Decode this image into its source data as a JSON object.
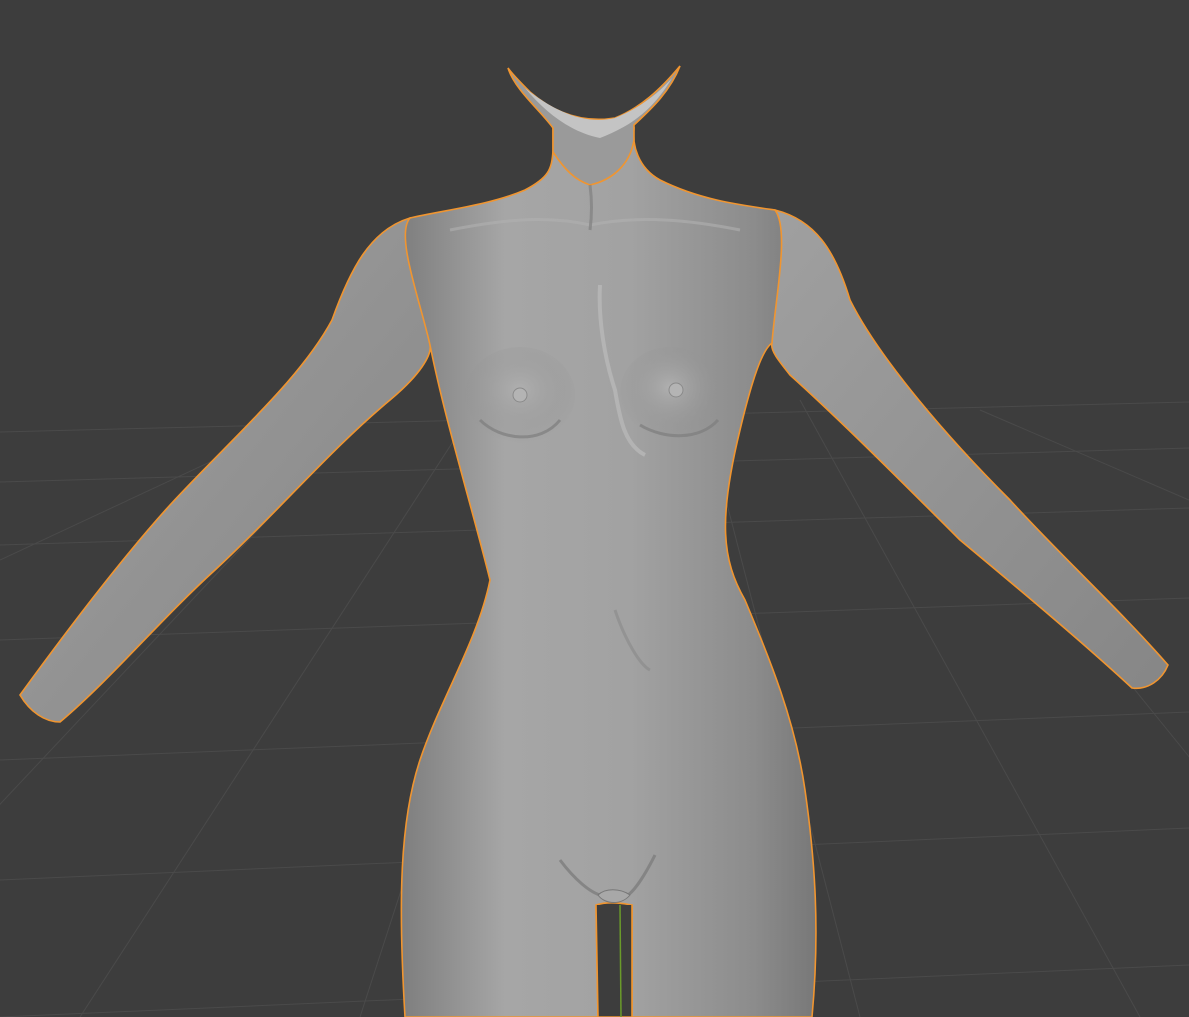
{
  "viewport": {
    "shading_mode": "solid",
    "object_selected": true,
    "object_subject": "sculpted mesh",
    "colors": {
      "background": "#3d3d3d",
      "grid": "#4a4a4a",
      "mesh": "#9a9a9a",
      "selection_outline": "#f09530",
      "axis_y": "#6a9a2a"
    }
  }
}
